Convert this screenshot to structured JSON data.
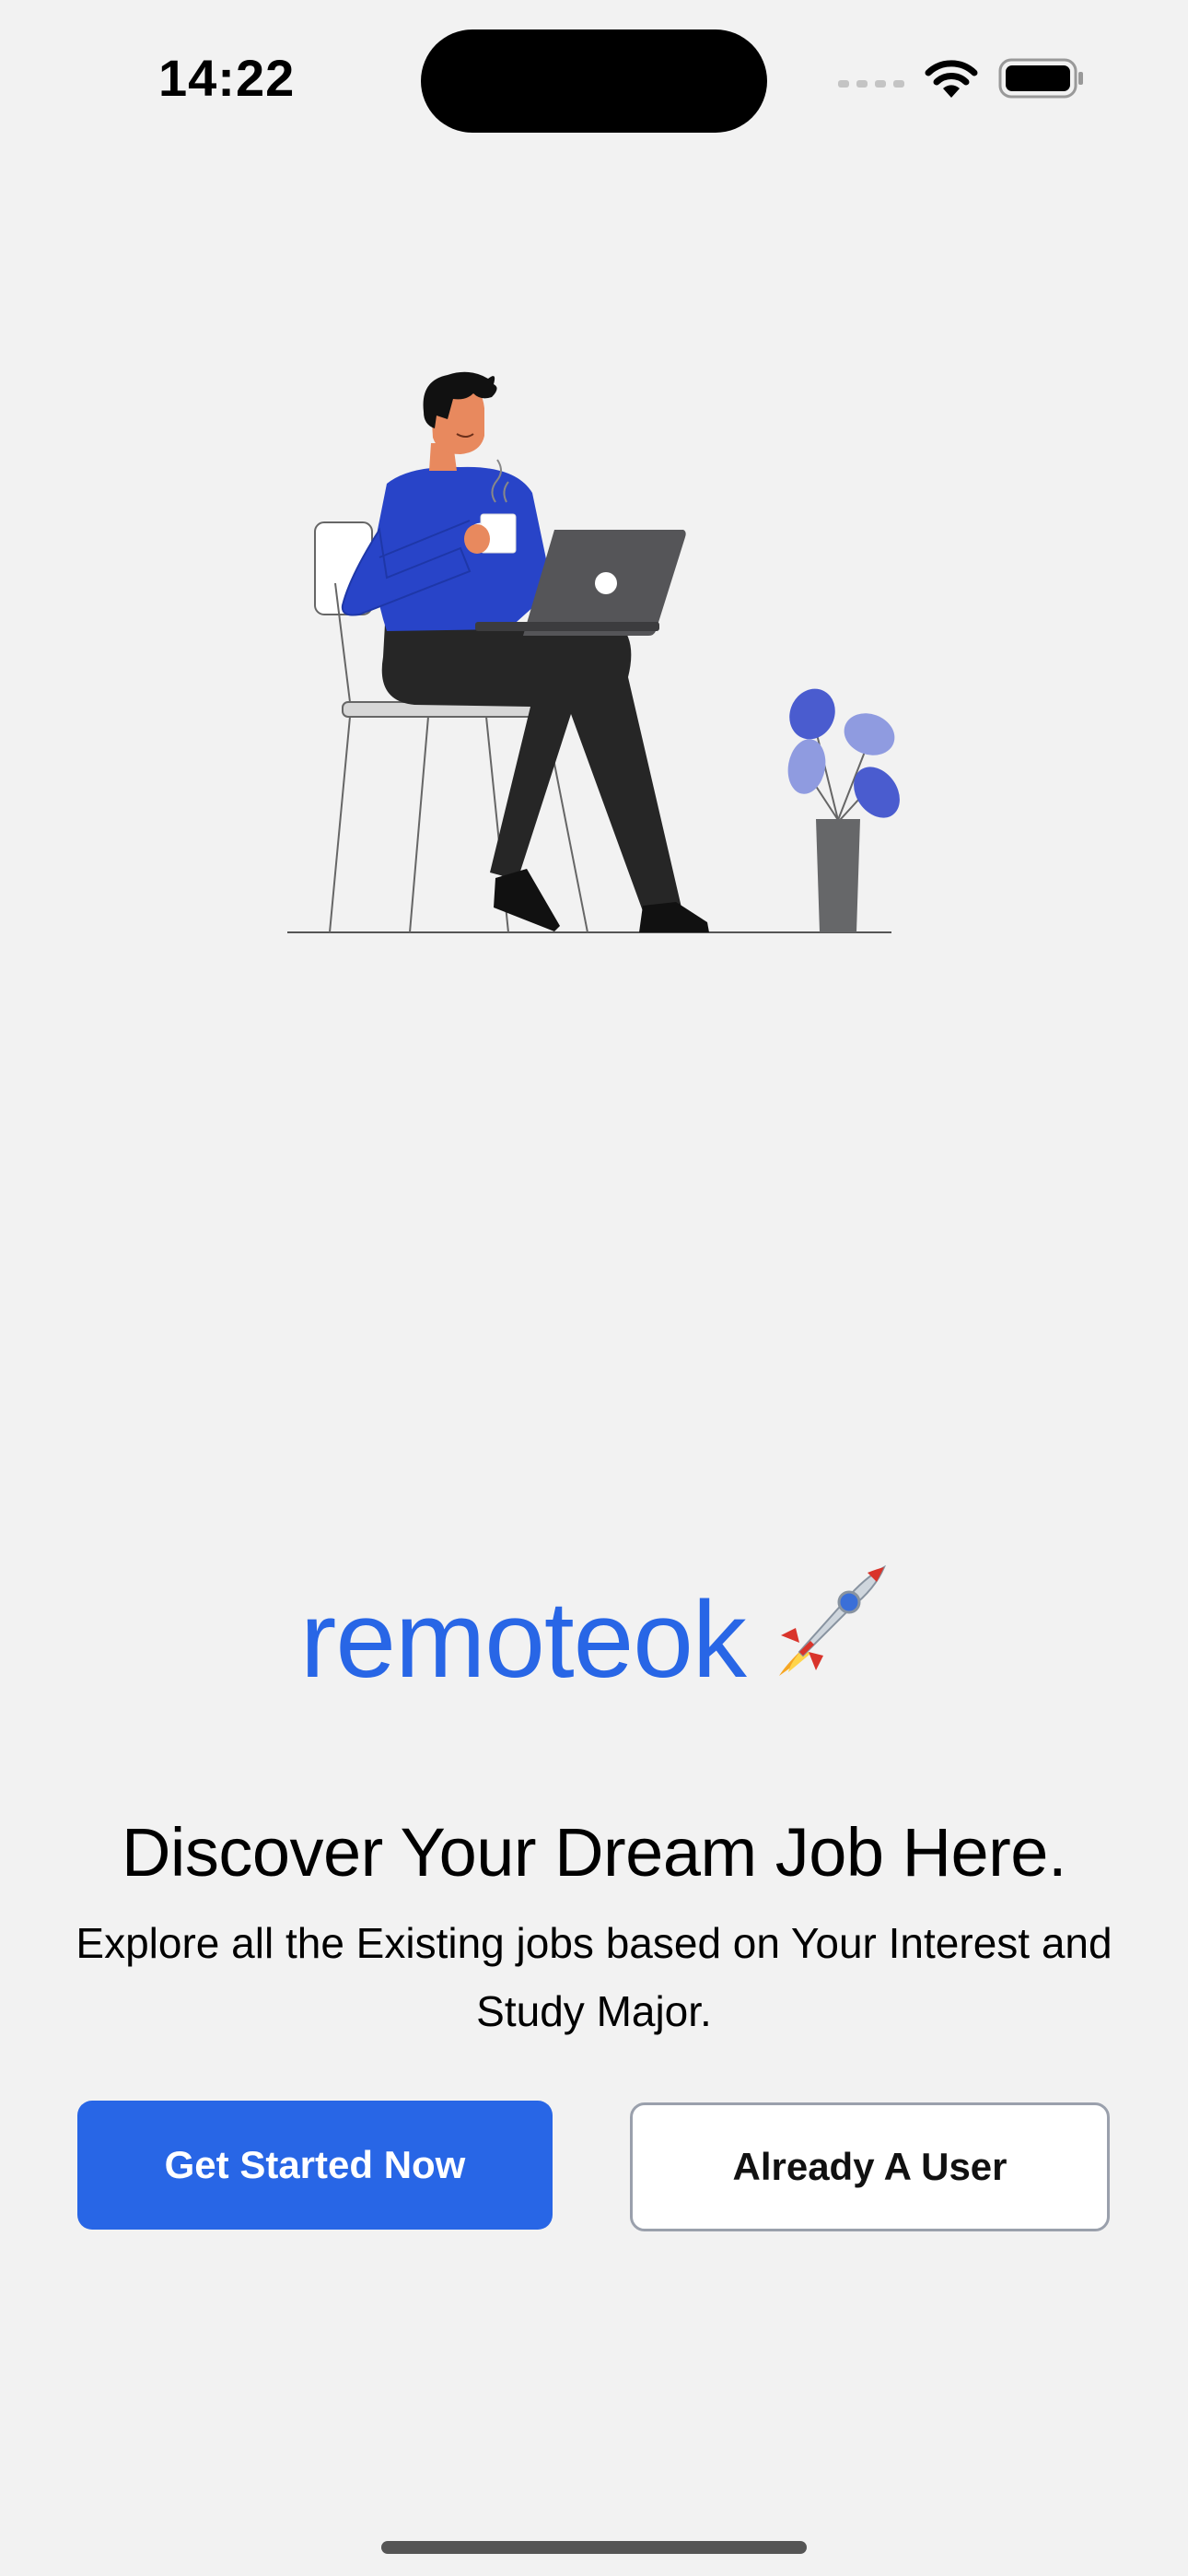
{
  "status_bar": {
    "time": "14:22"
  },
  "brand": {
    "name": "remoteok",
    "emoji": "🚀",
    "color": "#2866e6"
  },
  "hero": {
    "headline": "Discover Your Dream Job Here.",
    "subline": "Explore all the Existing jobs based on Your Interest and Study Major."
  },
  "buttons": {
    "get_started": "Get Started Now",
    "already_user": "Already A User"
  },
  "icons": {
    "signal": "cellular-signal-icon",
    "wifi": "wifi-icon",
    "battery": "battery-icon",
    "rocket": "rocket-icon"
  }
}
